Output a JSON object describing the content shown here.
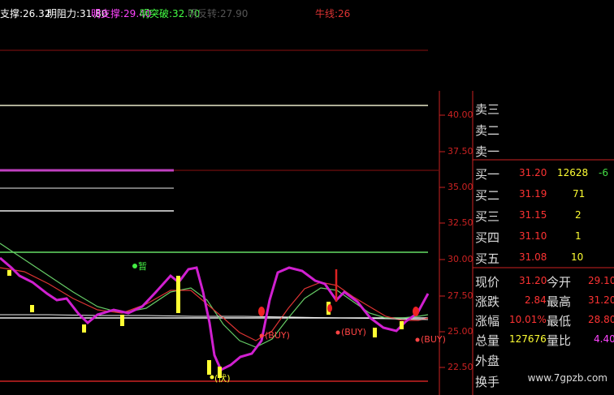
{
  "header": {
    "indicators": [
      {
        "label": "支撑:",
        "value": "26.32",
        "color": "#ffffff"
      },
      {
        "label": "明阻力:",
        "value": "31.80",
        "color": "#ffffff"
      },
      {
        "label": "明支撑:",
        "value": "29.40",
        "color": "#ff44ff"
      },
      {
        "label": "明突破:",
        "value": "32.70",
        "color": "#44ff44"
      },
      {
        "label": "明反转:",
        "value": "27.90",
        "color": "#555555"
      }
    ],
    "niuxian_label": "牛线:",
    "niuxian_value": "26"
  },
  "price_axis": [
    "40.00",
    "37.50",
    "35.00",
    "32.50",
    "30.00",
    "27.50",
    "25.00",
    "22.50"
  ],
  "markers": {
    "zan": "暂",
    "buy1": "(BUY)",
    "buy2": "(BUY)",
    "buy3": "(BUY)",
    "fu": "(伏)"
  },
  "quote": {
    "sell": [
      {
        "label": "卖三"
      },
      {
        "label": "卖二"
      },
      {
        "label": "卖一"
      }
    ],
    "buy": [
      {
        "label": "买一",
        "price": "31.20",
        "vol": "12628",
        "extra": "-6"
      },
      {
        "label": "买二",
        "price": "31.19",
        "vol": "71"
      },
      {
        "label": "买三",
        "price": "31.15",
        "vol": "2"
      },
      {
        "label": "买四",
        "price": "31.10",
        "vol": "1"
      },
      {
        "label": "买五",
        "price": "31.08",
        "vol": "10"
      }
    ],
    "stats": [
      {
        "l1": "现价",
        "v1": "31.20",
        "l2": "今开",
        "v2": "29.10"
      },
      {
        "l1": "涨跌",
        "v1": "2.84",
        "l2": "最高",
        "v2": "31.20"
      },
      {
        "l1": "涨幅",
        "v1": "10.01%",
        "l2": "最低",
        "v2": "28.80"
      },
      {
        "l1": "总量",
        "v1": "127676",
        "l2": "量比",
        "v2": "4.40"
      },
      {
        "l1": "外盘",
        "v1": "",
        "l2": "",
        "v2": ""
      },
      {
        "l1": "换手",
        "v1": "",
        "l2": "",
        "v2": ""
      }
    ]
  },
  "colors": {
    "magenta": "#d020d0",
    "red": "#cc2222",
    "yellow": "#ffff33",
    "green": "#88dd88"
  },
  "watermark": "www.7gpzb.com"
}
